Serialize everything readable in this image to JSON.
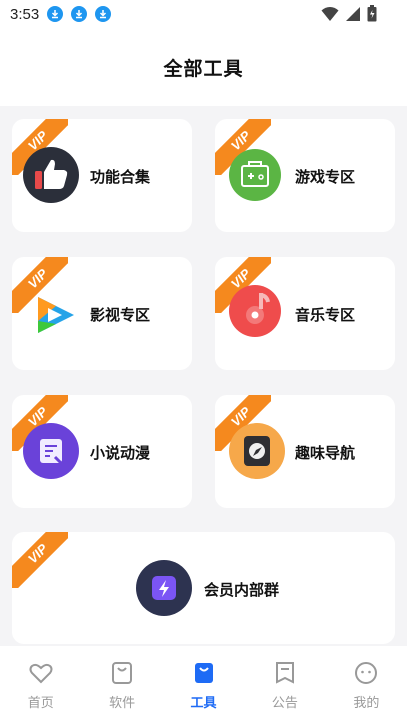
{
  "status_bar": {
    "time": "3:53",
    "icons": [
      "download-icon",
      "download-icon",
      "download-icon",
      "wifi-icon",
      "signal-icon",
      "battery-icon"
    ]
  },
  "header": {
    "title": "全部工具"
  },
  "badge": {
    "vip_text": "VIP",
    "color": "#f5891e"
  },
  "tools": [
    {
      "label": "功能合集",
      "icon": "thumbs-up-icon"
    },
    {
      "label": "游戏专区",
      "icon": "gamepad-icon"
    },
    {
      "label": "影视专区",
      "icon": "video-play-icon"
    },
    {
      "label": "音乐专区",
      "icon": "music-note-icon"
    },
    {
      "label": "小说动漫",
      "icon": "book-icon"
    },
    {
      "label": "趣味导航",
      "icon": "compass-icon"
    },
    {
      "label": "会员内部群",
      "icon": "lightning-icon"
    }
  ],
  "tabbar": {
    "active_color": "#1e6bf5",
    "items": [
      {
        "label": "首页",
        "icon": "heart-icon"
      },
      {
        "label": "软件",
        "icon": "bag-icon"
      },
      {
        "label": "工具",
        "icon": "bag-filled-icon"
      },
      {
        "label": "公告",
        "icon": "bookmark-icon"
      },
      {
        "label": "我的",
        "icon": "smiley-icon"
      }
    ]
  }
}
